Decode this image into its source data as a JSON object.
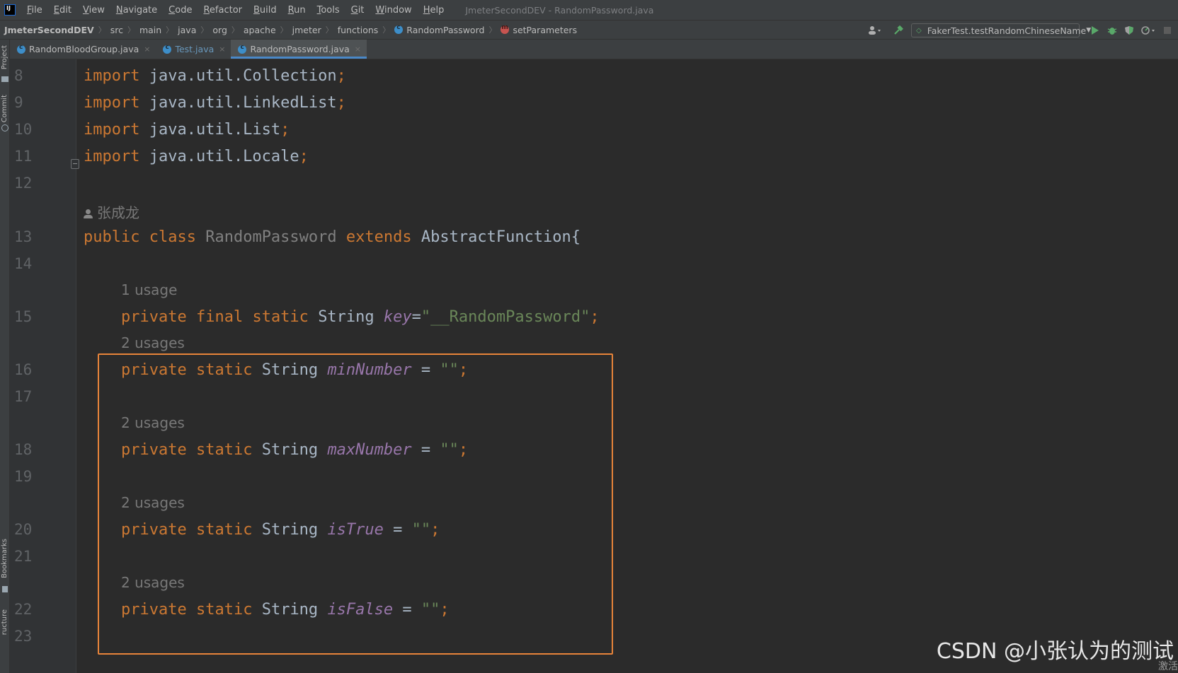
{
  "window": {
    "title": "JmeterSecondDEV - RandomPassword.java"
  },
  "menu": [
    {
      "mnemonic": "F",
      "rest": "ile"
    },
    {
      "mnemonic": "E",
      "rest": "dit"
    },
    {
      "mnemonic": "V",
      "rest": "iew"
    },
    {
      "mnemonic": "N",
      "rest": "avigate"
    },
    {
      "mnemonic": "C",
      "rest": "ode"
    },
    {
      "mnemonic": "R",
      "rest": "efactor"
    },
    {
      "mnemonic": "B",
      "rest": "uild"
    },
    {
      "mnemonic": "R",
      "rest": "un"
    },
    {
      "mnemonic": "T",
      "rest": "ools"
    },
    {
      "mnemonic": "G",
      "rest": "it"
    },
    {
      "mnemonic": "W",
      "rest": "indow"
    },
    {
      "mnemonic": "H",
      "rest": "elp"
    }
  ],
  "breadcrumb": {
    "project": "JmeterSecondDEV",
    "path": [
      "src",
      "main",
      "java",
      "org",
      "apache",
      "jmeter",
      "functions"
    ],
    "class_name": "RandomPassword",
    "method_name": "setParameters"
  },
  "run_config": {
    "label": "FakerTest.testRandomChineseName"
  },
  "side_tabs": {
    "project": "Project",
    "commit": "Commit",
    "bookmarks": "Bookmarks",
    "structure": "ructure"
  },
  "tabs": [
    {
      "label": "RandomBloodGroup.java"
    },
    {
      "label": "Test.java"
    },
    {
      "label": "RandomPassword.java"
    }
  ],
  "gutter": {
    "line_numbers": [
      "8",
      "9",
      "10",
      "11",
      "12",
      "13",
      "14",
      "15",
      "16",
      "17",
      "18",
      "19",
      "20",
      "21",
      "22",
      "23"
    ]
  },
  "code": {
    "imports": [
      {
        "kw": "import",
        "path": "java.util.Collection",
        "semi": ";"
      },
      {
        "kw": "import",
        "path": "java.util.LinkedList",
        "semi": ";"
      },
      {
        "kw": "import",
        "path": "java.util.List",
        "semi": ";"
      },
      {
        "kw": "import",
        "path": "java.util.Locale",
        "semi": ";"
      }
    ],
    "author": "张成龙",
    "class_decl": {
      "kw_public": "public",
      "kw_class": "class",
      "name": "RandomPassword",
      "kw_extends": "extends",
      "parent": "AbstractFunction",
      "brace": "{"
    },
    "key_field": {
      "usage": "1 usage",
      "kw1": "private",
      "kw2": "final",
      "kw3": "static",
      "type": "String",
      "name": "key",
      "eq": "=",
      "value": "\"__RandomPassword\"",
      "semi": ";"
    },
    "fields": [
      {
        "usage": "2 usages",
        "kw1": "private",
        "kw2": "static",
        "type": "String",
        "name": "minNumber",
        "eq": " = ",
        "value": "\"\"",
        "semi": ";"
      },
      {
        "usage": "2 usages",
        "kw1": "private",
        "kw2": "static",
        "type": "String",
        "name": "maxNumber",
        "eq": " = ",
        "value": "\"\"",
        "semi": ";"
      },
      {
        "usage": "2 usages",
        "kw1": "private",
        "kw2": "static",
        "type": "String",
        "name": "isTrue",
        "eq": " = ",
        "value": "\"\"",
        "semi": ";"
      },
      {
        "usage": "2 usages",
        "kw1": "private",
        "kw2": "static",
        "type": "String",
        "name": "isFalse",
        "eq": " = ",
        "value": "\"\"",
        "semi": ";"
      }
    ]
  },
  "watermark": {
    "text": "CSDN @小张认为的测试",
    "sub": "激活"
  },
  "colors": {
    "keyword": "#cc7832",
    "field": "#9876aa",
    "string": "#6a8759",
    "text": "#a9b7c6",
    "highlight_box": "#e8843a",
    "tab_underline": "#4a88c7"
  }
}
